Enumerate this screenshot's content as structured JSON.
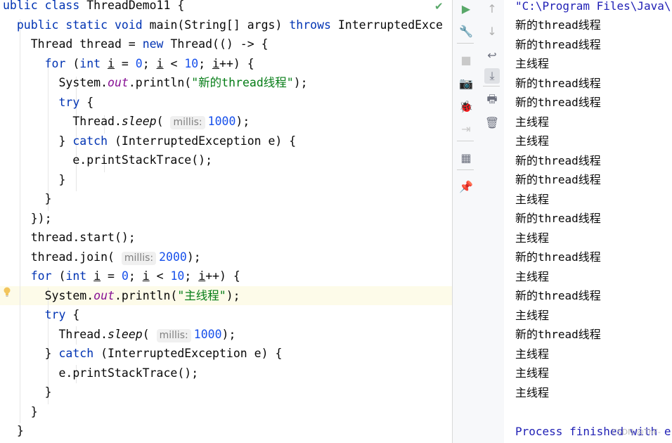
{
  "editor": {
    "lines": [
      [
        {
          "t": "ublic ",
          "c": "kw"
        },
        {
          "t": "class ",
          "c": "kw"
        },
        {
          "t": "ThreadDemo11 {"
        }
      ],
      [
        {
          "t": "  "
        },
        {
          "t": "public ",
          "c": "kw"
        },
        {
          "t": "static ",
          "c": "kw"
        },
        {
          "t": "void ",
          "c": "kw"
        },
        {
          "t": "main(String[] args) "
        },
        {
          "t": "throws ",
          "c": "kw"
        },
        {
          "t": "InterruptedExce"
        }
      ],
      [
        {
          "t": "    Thread thread = "
        },
        {
          "t": "new ",
          "c": "kw"
        },
        {
          "t": "Thread(() -> {"
        }
      ],
      [
        {
          "t": "      "
        },
        {
          "t": "for ",
          "c": "kw"
        },
        {
          "t": "("
        },
        {
          "t": "int ",
          "c": "kw"
        },
        {
          "t": "i",
          "c": "ul"
        },
        {
          "t": " = "
        },
        {
          "t": "0",
          "c": "num"
        },
        {
          "t": "; "
        },
        {
          "t": "i",
          "c": "ul"
        },
        {
          "t": " < "
        },
        {
          "t": "10",
          "c": "num"
        },
        {
          "t": "; "
        },
        {
          "t": "i",
          "c": "ul"
        },
        {
          "t": "++) {"
        }
      ],
      [
        {
          "t": "        System."
        },
        {
          "t": "out",
          "c": "fld"
        },
        {
          "t": ".println("
        },
        {
          "t": "\"新的thread线程\"",
          "c": "str"
        },
        {
          "t": ");"
        }
      ],
      [
        {
          "t": "        "
        },
        {
          "t": "try ",
          "c": "kw"
        },
        {
          "t": "{"
        }
      ],
      [
        {
          "t": "          Thread."
        },
        {
          "t": "sleep",
          "c": "it"
        },
        {
          "t": "( "
        },
        {
          "t": "millis:",
          "c": "hint"
        },
        {
          "t": "1000",
          "c": "num"
        },
        {
          "t": ");"
        }
      ],
      [
        {
          "t": "        } "
        },
        {
          "t": "catch ",
          "c": "kw"
        },
        {
          "t": "(InterruptedException e) {"
        }
      ],
      [
        {
          "t": "          e.printStackTrace();"
        }
      ],
      [
        {
          "t": "        }"
        }
      ],
      [
        {
          "t": "      }"
        }
      ],
      [
        {
          "t": "    });"
        }
      ],
      [
        {
          "t": "    thread.start();"
        }
      ],
      [
        {
          "t": "    thread.join( "
        },
        {
          "t": "millis:",
          "c": "hint"
        },
        {
          "t": "2000",
          "c": "num"
        },
        {
          "t": ");"
        }
      ],
      [
        {
          "t": "    "
        },
        {
          "t": "for ",
          "c": "kw"
        },
        {
          "t": "("
        },
        {
          "t": "int ",
          "c": "kw"
        },
        {
          "t": "i",
          "c": "ul"
        },
        {
          "t": " = "
        },
        {
          "t": "0",
          "c": "num"
        },
        {
          "t": "; "
        },
        {
          "t": "i",
          "c": "ul"
        },
        {
          "t": " < "
        },
        {
          "t": "10",
          "c": "num"
        },
        {
          "t": "; "
        },
        {
          "t": "i",
          "c": "ul"
        },
        {
          "t": "++) {"
        }
      ],
      [
        {
          "t": "      System."
        },
        {
          "t": "out",
          "c": "fld"
        },
        {
          "t": ".println("
        },
        {
          "t": "\"主线程\"",
          "c": "str"
        },
        {
          "t": ");"
        }
      ],
      [
        {
          "t": "      "
        },
        {
          "t": "try ",
          "c": "kw"
        },
        {
          "t": "{"
        }
      ],
      [
        {
          "t": "        Thread."
        },
        {
          "t": "sleep",
          "c": "it"
        },
        {
          "t": "( "
        },
        {
          "t": "millis:",
          "c": "hint"
        },
        {
          "t": "1000",
          "c": "num"
        },
        {
          "t": ");"
        }
      ],
      [
        {
          "t": "      } "
        },
        {
          "t": "catch ",
          "c": "kw"
        },
        {
          "t": "(InterruptedException e) {"
        }
      ],
      [
        {
          "t": "        e.printStackTrace();"
        }
      ],
      [
        {
          "t": "      }"
        }
      ],
      [
        {
          "t": "    }"
        }
      ],
      [
        {
          "t": "  }"
        }
      ]
    ],
    "highlighted_line": 15,
    "colors": {
      "keyword": "#0033b3",
      "number": "#1750eb",
      "string": "#067d17",
      "field": "#871094",
      "highlight": "#fdfbe9"
    }
  },
  "toolbar": {
    "items": [
      {
        "name": "run-icon",
        "glyph": "▶",
        "color": "#59a869"
      },
      {
        "name": "wrench-icon",
        "glyph": "🔧",
        "color": "#6c707e"
      },
      {
        "name": "stop-icon",
        "glyph": "■",
        "color": "#c9c9c9"
      },
      {
        "name": "camera-icon",
        "glyph": "📷",
        "color": "#c9c9c9"
      },
      {
        "name": "debug-icon",
        "glyph": "🐞",
        "color": "#c9c9c9"
      },
      {
        "name": "exit-icon",
        "glyph": "⇥",
        "color": "#c9c9c9"
      },
      {
        "name": "layout-icon",
        "glyph": "▦",
        "color": "#6c707e"
      },
      {
        "name": "pin-icon",
        "glyph": "📌",
        "color": "#6c707e"
      }
    ],
    "items2": [
      {
        "name": "up-arrow-icon",
        "glyph": "↑",
        "color": "#b0b0b0"
      },
      {
        "name": "down-arrow-icon",
        "glyph": "↓",
        "color": "#b0b0b0"
      },
      {
        "name": "soft-wrap-icon",
        "glyph": "↩",
        "color": "#6c707e"
      },
      {
        "name": "scroll-to-end-icon",
        "glyph": "⤓",
        "color": "#6c707e"
      },
      {
        "name": "print-icon",
        "glyph": "🖶",
        "color": "#6c707e"
      },
      {
        "name": "trash-icon",
        "glyph": "🗑",
        "color": "#6c707e"
      }
    ]
  },
  "console": {
    "command": "\"C:\\Program Files\\Java\\",
    "output": [
      "新的thread线程",
      "新的thread线程",
      "主线程",
      "新的thread线程",
      "新的thread线程",
      "主线程",
      "主线程",
      "新的thread线程",
      "新的thread线程",
      "主线程",
      "新的thread线程",
      "主线程",
      "新的thread线程",
      "主线程",
      "新的thread线程",
      "主线程",
      "新的thread线程",
      "主线程",
      "主线程",
      "主线程"
    ],
    "process_finished": "Process finished with e",
    "watermark": "CSDN @ThF-"
  }
}
